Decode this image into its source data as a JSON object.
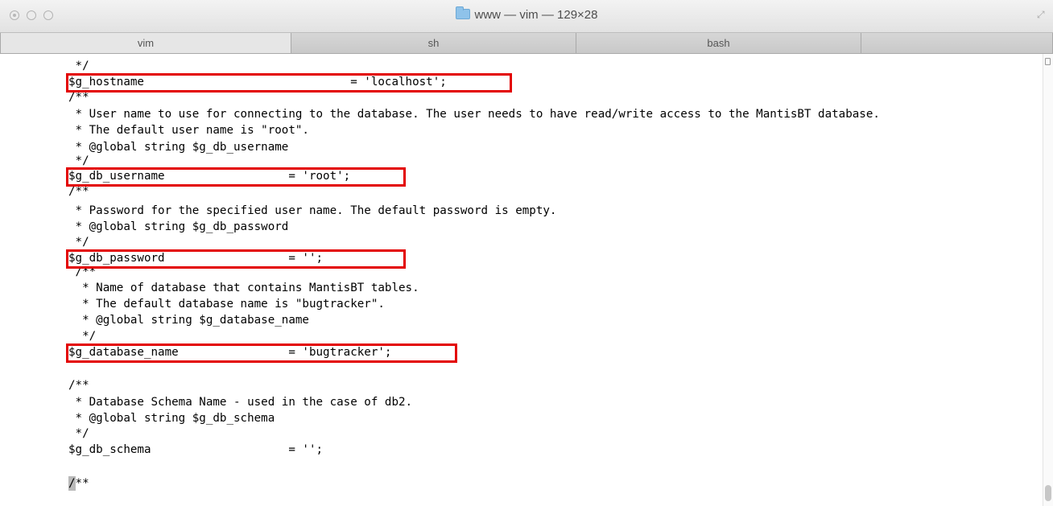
{
  "window": {
    "title": "www — vim — 129×28"
  },
  "tabs": [
    {
      "label": "vim"
    },
    {
      "label": "sh"
    },
    {
      "label": "bash"
    }
  ],
  "editor": {
    "lines": [
      " */",
      "$g_hostname                              = 'localhost';",
      "/**",
      " * User name to use for connecting to the database. The user needs to have read/write access to the MantisBT database.",
      " * The default user name is \"root\".",
      " * @global string $g_db_username",
      " */",
      "$g_db_username                  = 'root';",
      "/**",
      " * Password for the specified user name. The default password is empty.",
      " * @global string $g_db_password",
      " */",
      "$g_db_password                  = '';",
      " /**",
      "  * Name of database that contains MantisBT tables.",
      "  * The default database name is \"bugtracker\".",
      "  * @global string $g_database_name",
      "  */",
      "$g_database_name                = 'bugtracker';",
      "",
      "/**",
      " * Database Schema Name - used in the case of db2.",
      " * @global string $g_db_schema",
      " */",
      "$g_db_schema                    = '';",
      "",
      "/**"
    ]
  },
  "colors": {
    "highlight": "#e30000"
  }
}
